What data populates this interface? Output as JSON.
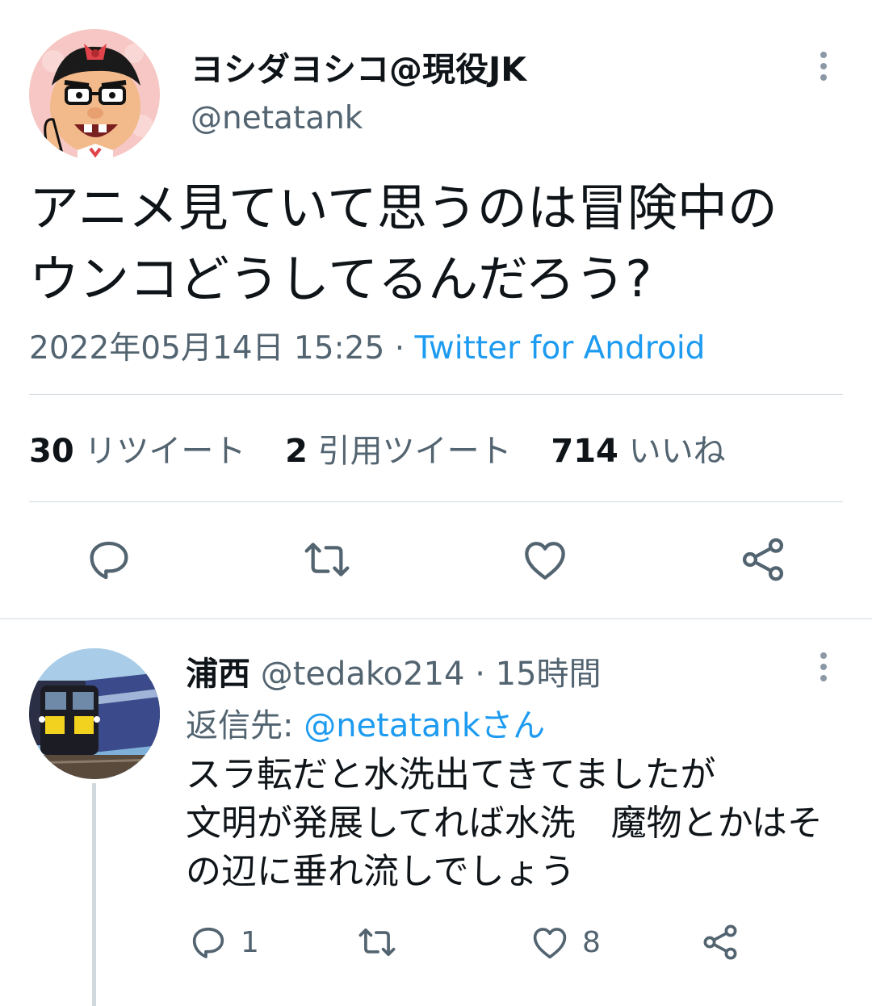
{
  "main_tweet": {
    "display_name": "ヨシダヨシコ@現役JK",
    "handle": "@netatank",
    "text_lines": [
      "アニメ見ていて思うのは冒険中の",
      "ウンコどうしてるんだろう?"
    ],
    "timestamp": "2022年05月14日 15:25",
    "separator": " · ",
    "source": "Twitter for Android",
    "stats": {
      "retweets_count": "30",
      "retweets_label": "リツイート",
      "quotes_count": "2",
      "quotes_label": "引用ツイート",
      "likes_count": "714",
      "likes_label": "いいね"
    }
  },
  "reply": {
    "display_name": "浦西",
    "handle": "@tedako214",
    "separator": " · ",
    "time": "15時間",
    "replying_prefix": "返信先: ",
    "replying_mention": "@netatankさん",
    "text_lines": [
      "スラ転だと水洗出てきてましたが",
      "文明が発展してれば水洗　魔物とかはそ",
      "の辺に垂れ流しでしょう"
    ],
    "reply_count": "1",
    "retweet_count": "",
    "like_count": "8"
  },
  "colors": {
    "accent": "#1d9bf0",
    "secondary_text": "#536471",
    "primary_text": "#0f1419",
    "divider": "#cfd9de"
  },
  "icons": [
    "more-vertical-icon",
    "reply-icon",
    "retweet-icon",
    "like-icon",
    "share-icon"
  ]
}
